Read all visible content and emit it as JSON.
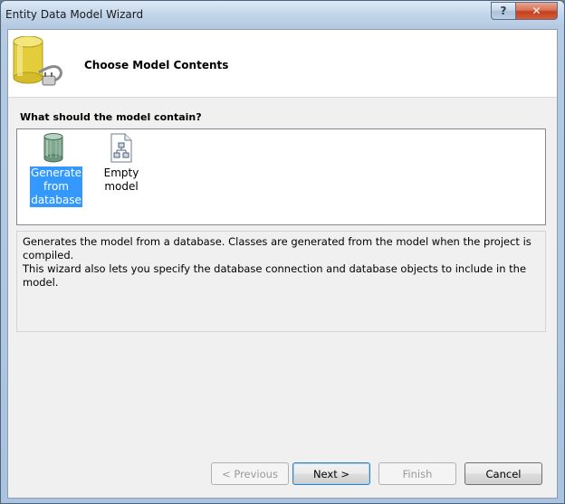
{
  "window": {
    "title": "Entity Data Model Wizard"
  },
  "titlebar": {
    "help_label": "?",
    "close_label": "✕"
  },
  "header": {
    "title": "Choose Model Contents"
  },
  "question": "What should the model contain?",
  "options": [
    {
      "label_lines": [
        "Generate",
        "from",
        "database"
      ],
      "selected": true
    },
    {
      "label_lines": [
        "Empty model"
      ],
      "selected": false
    }
  ],
  "description": {
    "line1": "Generates the model from a database. Classes are generated from the model when the project is compiled.",
    "line2": "This wizard also lets you specify the database connection and database objects to include in the model."
  },
  "buttons": {
    "previous": "< Previous",
    "next": "Next >",
    "finish": "Finish",
    "cancel": "Cancel"
  },
  "colors": {
    "selection": "#3399ff",
    "header_icon": "#e8d44a"
  }
}
